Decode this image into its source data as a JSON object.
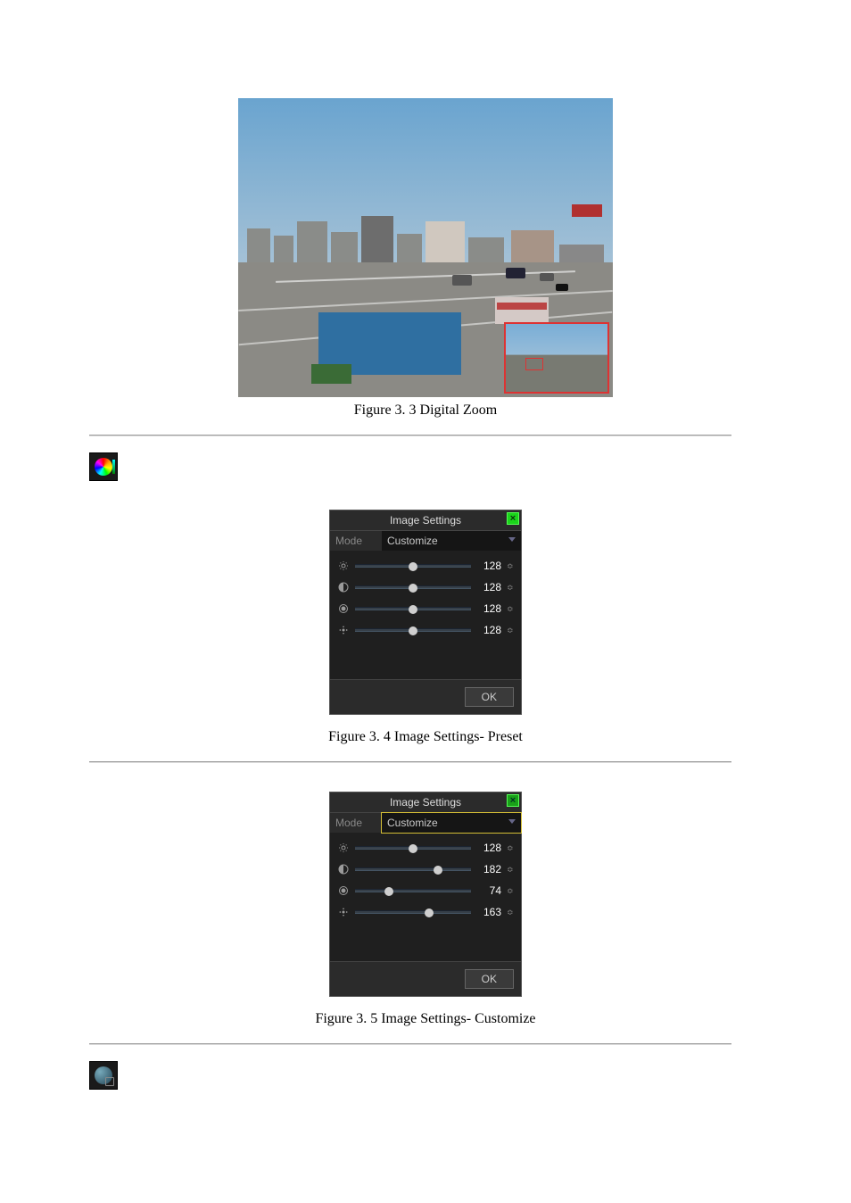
{
  "figures": {
    "zoom_caption": "Figure 3. 3  Digital Zoom",
    "preset_caption": "Figure 3. 4 Image Settings- Preset",
    "customize_caption": "Figure 3. 5 Image Settings- Customize"
  },
  "panel": {
    "title": "Image Settings",
    "mode_label": "Mode",
    "mode_value": "Customize",
    "ok_label": "OK",
    "close_glyph": "×",
    "spinner_glyph": "≎"
  },
  "preset_values": {
    "brightness": 128,
    "contrast": 128,
    "saturation": 128,
    "hue": 128
  },
  "customize_values": {
    "brightness": 128,
    "contrast": 182,
    "saturation": 74,
    "hue": 163
  },
  "slider_max": 255
}
